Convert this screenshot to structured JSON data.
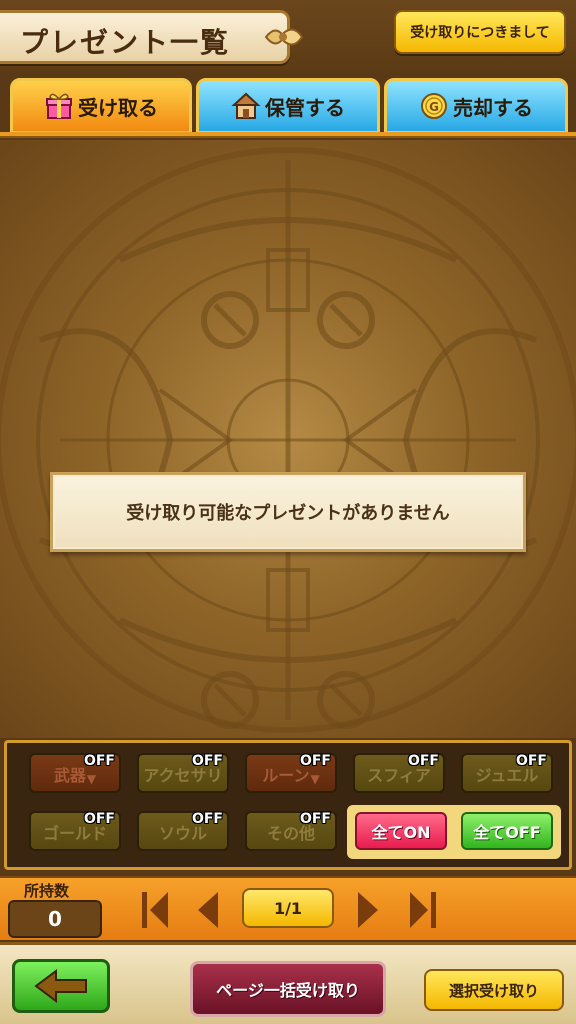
{
  "header": {
    "title": "プレゼント一覧",
    "notice_button": "受け取りにつきまして"
  },
  "tabs": [
    {
      "label": "受け取る",
      "icon": "gift-icon",
      "active": true
    },
    {
      "label": "保管する",
      "icon": "house-icon",
      "active": false
    },
    {
      "label": "売却する",
      "icon": "gold-coin-icon",
      "active": false
    }
  ],
  "main": {
    "empty_message": "受け取り可能なプレゼントがありません"
  },
  "filters": {
    "state_label": "OFF",
    "items": [
      {
        "label": "武器",
        "has_dropdown": true,
        "state": "OFF"
      },
      {
        "label": "アクセサリ",
        "has_dropdown": false,
        "state": "OFF"
      },
      {
        "label": "ルーン",
        "has_dropdown": true,
        "state": "OFF"
      },
      {
        "label": "スフィア",
        "has_dropdown": false,
        "state": "OFF"
      },
      {
        "label": "ジュエル",
        "has_dropdown": false,
        "state": "OFF"
      },
      {
        "label": "ゴールド",
        "has_dropdown": false,
        "state": "OFF"
      },
      {
        "label": "ソウル",
        "has_dropdown": false,
        "state": "OFF"
      },
      {
        "label": "その他",
        "has_dropdown": false,
        "state": "OFF"
      }
    ],
    "all_on": "全てON",
    "all_off": "全てOFF",
    "dropdown_glyph": "▼"
  },
  "pager": {
    "owned_label": "所持数",
    "owned_count": "0",
    "page": "1/1"
  },
  "bottom": {
    "bulk_receive": "ページ一括受け取り",
    "select_receive": "選択受け取り"
  },
  "colors": {
    "tab_active": "#f28a10",
    "tab_inactive": "#28a8e6",
    "all_on": "#e81c4e",
    "all_off": "#32b41e",
    "back_button": "#2ea81a",
    "bulk_button": "#6a1226"
  }
}
